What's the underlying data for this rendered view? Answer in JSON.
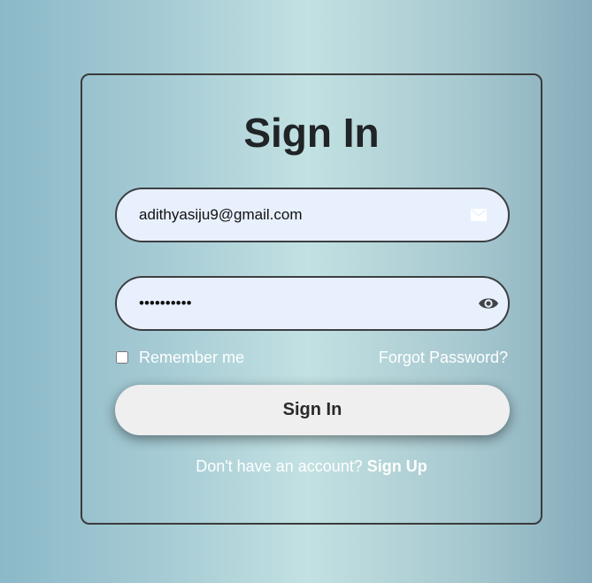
{
  "form": {
    "title": "Sign In",
    "email": {
      "value": "adithyasiju9@gmail.com",
      "icon": "mail-icon"
    },
    "password": {
      "masked_value": "••••••••••",
      "icon": "eye-icon"
    },
    "remember_label": "Remember me",
    "remember_checked": false,
    "forgot_label": "Forgot Password?",
    "submit_label": "Sign In",
    "signup_prompt": "Don't have an account?",
    "signup_link": "Sign Up"
  },
  "colors": {
    "background_gradient": [
      "#8bb9c8",
      "#c2e1e2",
      "#86adbc"
    ],
    "input_bg": "#e8f0fe",
    "button_bg": "#efefef",
    "text_light": "#ffffff",
    "title": "#202426"
  }
}
